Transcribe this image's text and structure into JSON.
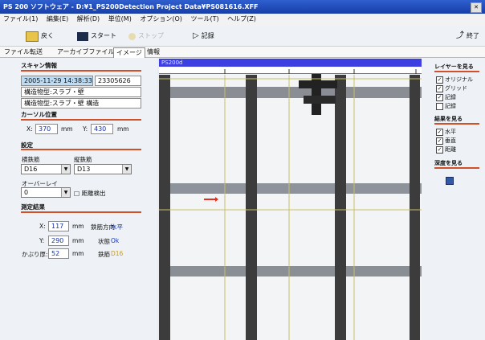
{
  "window": {
    "title": "PS 200 ソフトウェア - D:¥1_PS200Detection Project Data¥PS081616.XFF"
  },
  "menu": [
    "ファイル(1)",
    "編集(E)",
    "解析(D)",
    "単位(M)",
    "オプション(O)",
    "ツール(T)",
    "ヘルプ(Z)"
  ],
  "toolbar": {
    "back": "戻く",
    "start": "スタート",
    "stop": "ストップ",
    "record": "記録",
    "exit": "終了"
  },
  "tabs": [
    "ファイル転送",
    "アーカイブファイル",
    "イメージ",
    "情報"
  ],
  "scan_info": {
    "heading": "スキャン情報",
    "datetime": "2005-11-29 14:38:33",
    "serial": "23305626",
    "line1": "構造物型:スラブ・壁",
    "line2": "構造物型:スラブ・壁 構造"
  },
  "cursor": {
    "heading": "カーソル位置",
    "x_label": "X:",
    "x_value": "370",
    "x_unit": "mm",
    "y_label": "Y:",
    "y_value": "430",
    "y_unit": "mm"
  },
  "settings": {
    "heading": "設定",
    "horiz_label": "横鉄筋",
    "horiz_value": "D16",
    "vert_label": "縦鉄筋",
    "vert_value": "D13",
    "overlay_label": "オーバーレイ",
    "overlay_value": "0",
    "threshold_label": "□ 距離検出"
  },
  "measure": {
    "heading": "測定結果",
    "x_label": "X:",
    "x_value": "117",
    "x_unit": "mm",
    "dir_label": "鉄筋方向",
    "dir_value": "水平",
    "y_label": "Y:",
    "y_value": "290",
    "y_unit": "mm",
    "status_label": "状態",
    "status_value": "Ok",
    "cover_label": "かぶり厚:",
    "cover_value": "52",
    "cover_unit": "mm",
    "dia_label": "鉄筋",
    "dia_value": "D16"
  },
  "image": {
    "header": "PS200d"
  },
  "layers": {
    "heading": "レイヤーを見る",
    "items": [
      {
        "label": "オリジナル",
        "checked": true
      },
      {
        "label": "グリッド",
        "checked": true
      },
      {
        "label": "記録",
        "checked": true
      },
      {
        "label": "記録",
        "checked": false
      }
    ]
  },
  "results": {
    "heading": "結果を見る",
    "items": [
      {
        "label": "水平",
        "checked": true
      },
      {
        "label": "垂直",
        "checked": true
      },
      {
        "label": "距離",
        "checked": true
      }
    ]
  },
  "depth": {
    "heading": "深度を見る",
    "icon": "depth-icon"
  },
  "colors": {
    "accent_line": "#d0502a",
    "title_blue": "#173ea7",
    "image_header": "#3d3fe0",
    "bar_dark": "#3c3c3c"
  }
}
